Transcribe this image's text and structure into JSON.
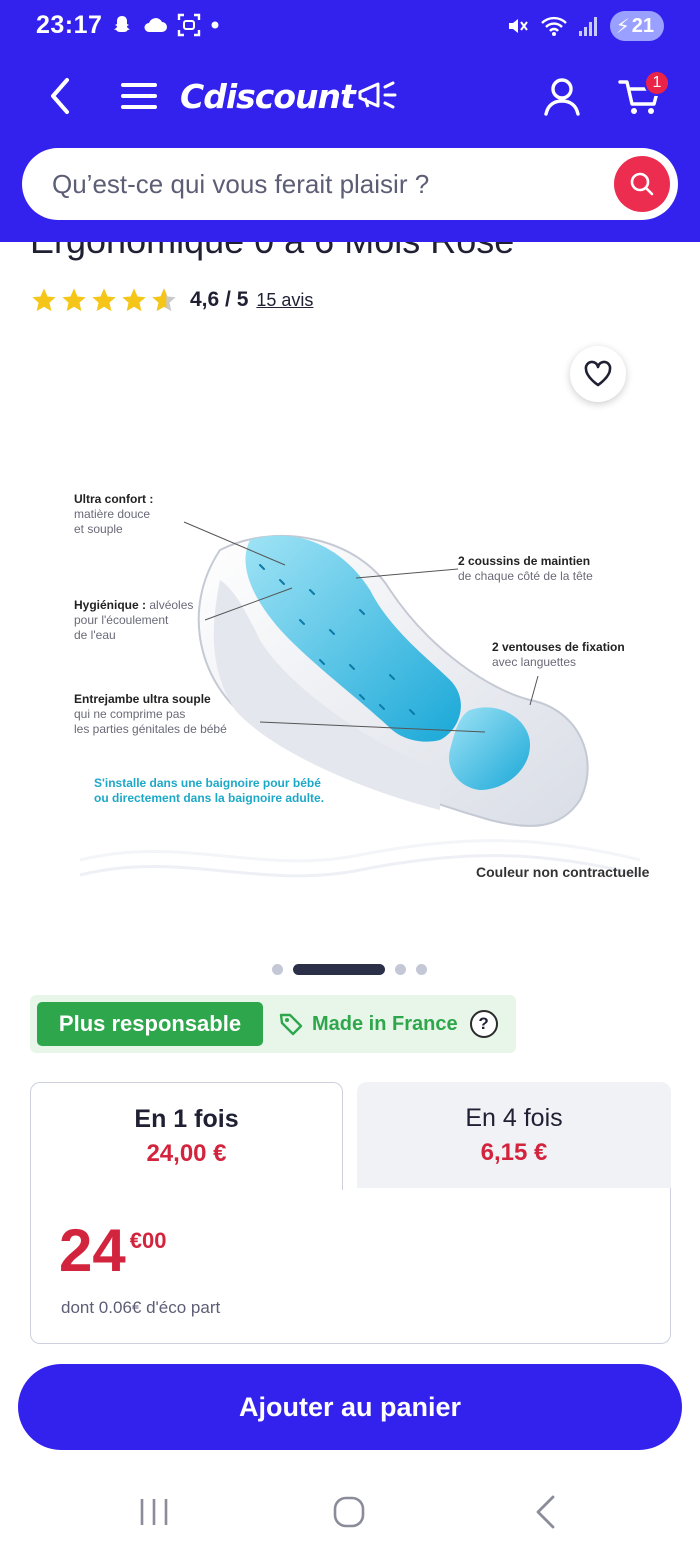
{
  "status_bar": {
    "time": "23:17",
    "battery": "21",
    "icons_left": [
      "snapchat-icon",
      "cloud-icon",
      "screenshot-icon",
      "dot-icon"
    ],
    "icons_right": [
      "mute-icon",
      "wifi-icon",
      "signal-icon",
      "battery-icon"
    ]
  },
  "header": {
    "logo_text": "Cdiscount",
    "cart_count": "1",
    "search_placeholder": "Qu’est-ce qui vous ferait plaisir ?",
    "colors": {
      "brand": "#3321ee",
      "search_button": "#ec2d4f"
    }
  },
  "product": {
    "title_partial": "Ergonomique 0 à 6 Mois Rose",
    "rating_value": "4,6 / 5",
    "rating_count": "15 avis",
    "stars": 4.6,
    "image": {
      "labels": [
        {
          "title": "Ultra confort :",
          "text": "matière douce\net souple"
        },
        {
          "title": "Hygiénique :",
          "text": " alvéoles\npour l'écoulement\nde l'eau"
        },
        {
          "title": "Entrejambe ultra souple",
          "text": "qui ne comprime pas\nles parties génitales de bébé"
        },
        {
          "title": "2 coussins de maintien",
          "text": "de chaque côté de la tête"
        },
        {
          "title": "2 ventouses de fixation",
          "text": "avec languettes"
        }
      ],
      "install_note": "S'installe dans une baignoire pour bébé\nou directement dans la baignoire adulte.",
      "caption": "Couleur non contractuelle"
    },
    "carousel": {
      "total": 4,
      "active": 1
    }
  },
  "badges": {
    "responsible": "Plus responsable",
    "made_in": "Made in France",
    "help": "?"
  },
  "payment": {
    "tabs": [
      {
        "label": "En 1 fois",
        "price": "24,00 €"
      },
      {
        "label": "En 4 fois",
        "price": "6,15 €"
      }
    ],
    "price_int": "24",
    "price_dec": "€00",
    "eco_part": "dont 0.06€ d'éco part",
    "color": "#d3243d"
  },
  "cta": {
    "add_to_cart": "Ajouter au panier"
  },
  "system_nav": [
    "recents-icon",
    "home-icon",
    "back-icon"
  ]
}
